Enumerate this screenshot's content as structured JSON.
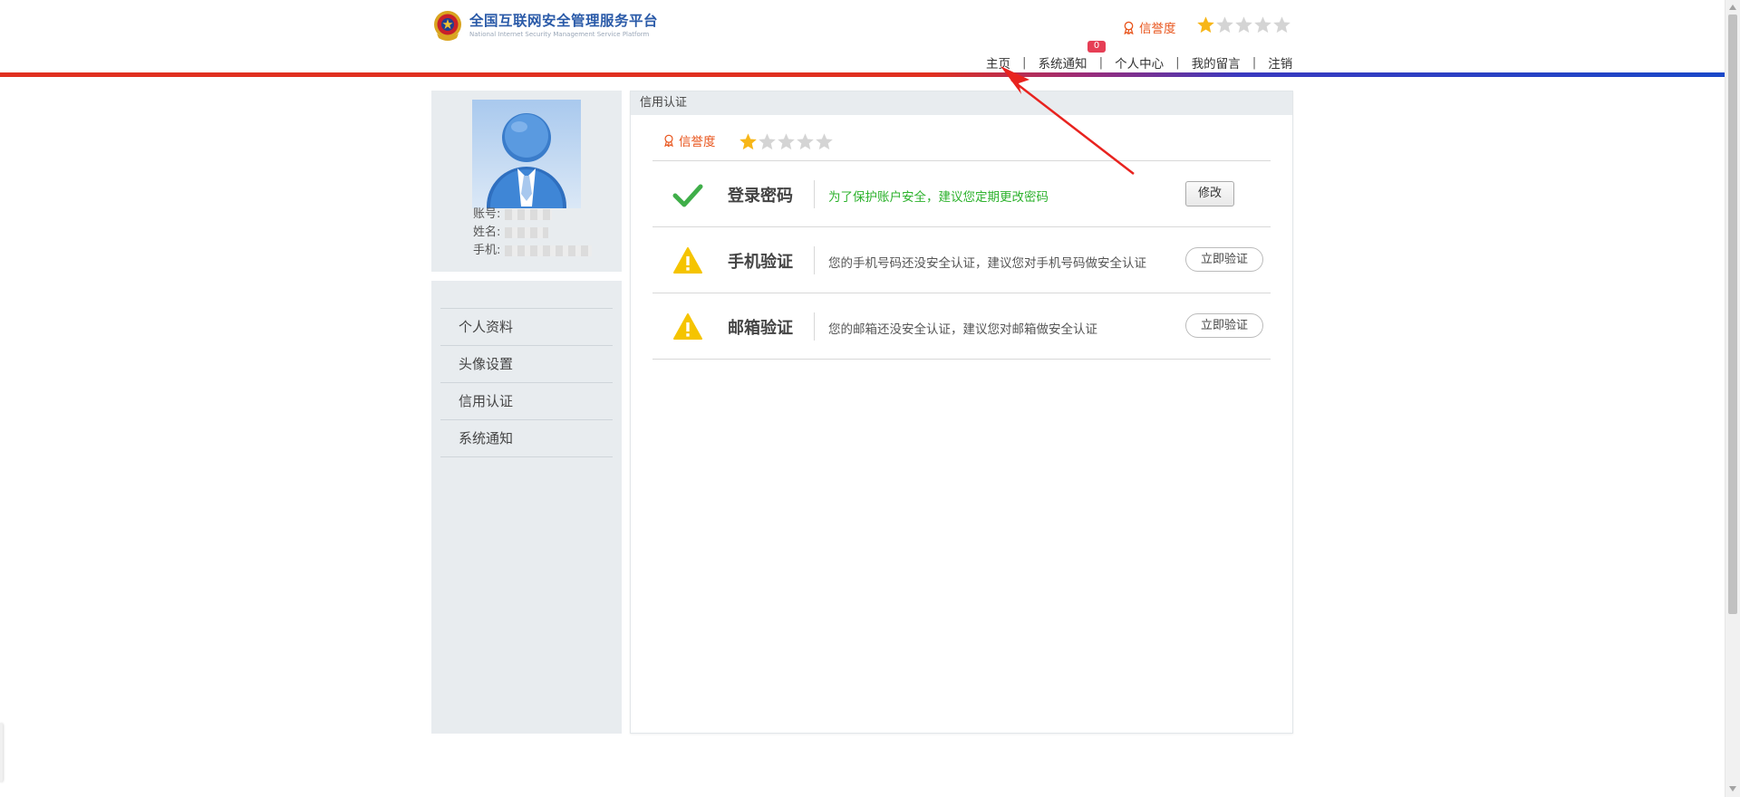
{
  "header": {
    "logo_cn": "全国互联网安全管理服务平台",
    "logo_en": "National Internet Security Management Service Platform",
    "credit_label": "信誉度",
    "credit_rating": 1,
    "credit_max": 5,
    "nav": {
      "home": "主页",
      "notifications": "系统通知",
      "notifications_badge": "0",
      "user_center": "个人中心",
      "my_messages": "我的留言",
      "logout": "注销"
    }
  },
  "profile": {
    "account_label": "账号:",
    "name_label": "姓名:",
    "phone_label": "手机:"
  },
  "sidebar": {
    "items": [
      {
        "label": "个人资料"
      },
      {
        "label": "头像设置"
      },
      {
        "label": "信用认证"
      },
      {
        "label": "系统通知"
      }
    ]
  },
  "main": {
    "panel_title": "信用认证",
    "credit_label": "信誉度",
    "credit_rating": 1,
    "rows": [
      {
        "title": "登录密码",
        "desc": "为了保护账户安全，建议您定期更改密码",
        "status": "ok",
        "button": "修改"
      },
      {
        "title": "手机验证",
        "desc": "您的手机号码还没安全认证，建议您对手机号码做安全认证",
        "status": "warning",
        "button": "立即验证"
      },
      {
        "title": "邮箱验证",
        "desc": "您的邮箱还没安全认证，建议您对邮箱做安全认证",
        "status": "warning",
        "button": "立即验证"
      }
    ]
  },
  "colors": {
    "accent_orange": "#e8531a",
    "ok_green": "#2db22d",
    "warning_yellow": "#f5c400",
    "badge_red": "#e63e55",
    "star_gold": "#f7b618",
    "star_gray": "#d4d4d4"
  }
}
